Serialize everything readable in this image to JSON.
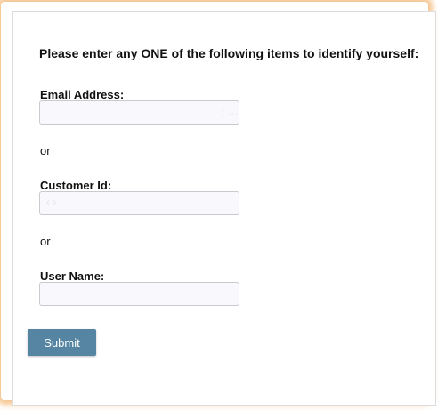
{
  "form": {
    "heading": "Please enter any ONE of the following items to identify yourself:",
    "email_label": "Email Address:",
    "email_value": "",
    "or_1": "or",
    "customer_id_label": "Customer Id:",
    "customer_id_value": "",
    "or_2": "or",
    "username_label": "User Name:",
    "username_value": "",
    "submit_label": "Submit"
  },
  "colors": {
    "accent_button": "#5685a3",
    "frame_glow": "#f6c58f",
    "field_background": "#f9f9fd"
  }
}
